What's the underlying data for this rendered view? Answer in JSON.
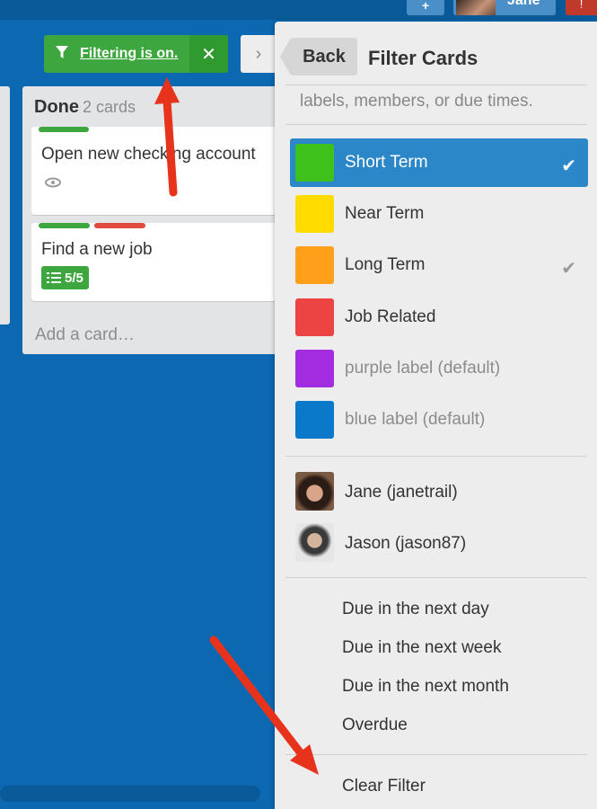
{
  "header": {
    "add_button_label": "+",
    "username": "Jane",
    "notification_glyph": "!"
  },
  "filter_indicator": {
    "label": "Filtering is on.",
    "icon": "filter-icon",
    "close_glyph": "✕"
  },
  "menu_toggle_glyph": "›",
  "list": {
    "title": "Done",
    "count": "2 cards",
    "cards": [
      {
        "title": "Open new checking account",
        "labels": [
          "#3ea63e"
        ],
        "badge_icon": "eye-icon"
      },
      {
        "title": "Find a new job",
        "labels": [
          "#3ea63e",
          "#e04a3f"
        ],
        "checklist": "5/5"
      }
    ],
    "add_card": "Add a card…"
  },
  "panel": {
    "back_label": "Back",
    "title": "Filter Cards",
    "hint": "labels, members, or due times.",
    "labels": [
      {
        "name": "Short Term",
        "color": "#3ec11b",
        "checked": true,
        "selected": true
      },
      {
        "name": "Near Term",
        "color": "#ffdb00",
        "checked": false
      },
      {
        "name": "Long Term",
        "color": "#ff9f1a",
        "checked": true
      },
      {
        "name": "Job Related",
        "color": "#eb4443",
        "checked": false
      },
      {
        "name": "purple label (default)",
        "color": "#a32be0",
        "checked": false
      },
      {
        "name": "blue label (default)",
        "color": "#0a79c9",
        "checked": false
      }
    ],
    "members": [
      {
        "name": "Jane (janetrail)"
      },
      {
        "name": "Jason (jason87)"
      }
    ],
    "due": [
      "Due in the next day",
      "Due in the next week",
      "Due in the next month",
      "Overdue"
    ],
    "clear": "Clear Filter"
  },
  "colors": {
    "board": "#0c68b0",
    "accent_green": "#3ea63e",
    "selected_row": "#2b87c8",
    "annotation_arrow": "#e8331c"
  }
}
